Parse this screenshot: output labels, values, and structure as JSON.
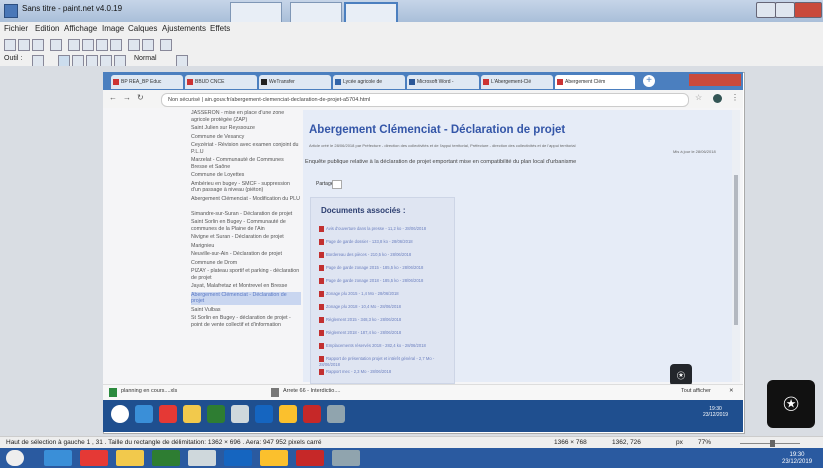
{
  "app": {
    "title": "Sans titre - paint.net v4.0.19"
  },
  "menu": [
    "Fichier",
    "Edition",
    "Affichage",
    "Image",
    "Calques",
    "Ajustements",
    "Effets"
  ],
  "toolbar": {
    "tool_label": "Outil :",
    "blend_label": "Normal"
  },
  "browser": {
    "tabs": [
      "BP REA_BP Educ",
      "BBUD CNCE",
      "WeTransfer",
      "Lycée agricole de",
      "Microsoft Word -",
      "L'Abergement-Clé",
      "Abergement Clém"
    ],
    "url": "Non sécurisé | ain.gouv.fr/abergement-clemenciat-declaration-de-projet-a5704.html"
  },
  "sidebar": {
    "items": [
      "JASSERON - mise en place d'une zone agricole protégée (ZAP)",
      "Saint Julien sur Reyssouze",
      "Commune de Vesancy",
      "Ceyzériat - Révision avec examen conjoint du P.L.U",
      "Marzelat - Communauté de Communes Bresse et Saône",
      "Commune de Loyettes",
      "Ambérieu en bugey - SMCF - suppression d'un passage à niveau (piéton)",
      "Abergement Clémenciat - Modification du PLU",
      "Simandre-sur-Suran - Déclaration de projet",
      "Saint Sorlin en Bugey - Communauté de communes de la Plaine de l'Ain",
      "Nivigne et Suran - Déclaration de projet",
      "Marignieu",
      "Neuville-sur-Ain - Déclaration de projet",
      "Commune de Drom",
      "PIZAY - plateau sportif et parking - déclaration de projet",
      "Jayat, Malafretaz et Montrevel en Bresse",
      "Abergement Clémenciat - Déclaration de projet",
      "Saint Vulbas",
      "St Sorlin en Bugey - déclaration de projet - point de vente collectif et d'information"
    ],
    "active_index": 16
  },
  "content": {
    "title": "Abergement Clémenciat - Déclaration de projet",
    "meta": "Article créé le 28/06/2018 par Préfecture - direction des collectivités et de l'appui territorial, Préfecture - direction des collectivités et de l'appui territorial",
    "meta_date": "Mis à jour le 28/06/2018",
    "intro": "Enquête publique relative à la déclaration de projet emportant mise en compatibilité du plan local d'urbanisme",
    "share_label": "Partager",
    "docs_title": "Documents associés :",
    "documents": [
      "Avis d'ouverture dans la presse - 11,2 ko - 28/06/2018",
      "Page de garde dossier - 133,8 ko - 28/06/2018",
      "Bordereau des pièces - 210,5 ko - 28/06/2018",
      "Page de garde zonage 2015 - 185,5 ko - 28/06/2018",
      "Page de garde zonage 2018 - 185,5 ko - 28/06/2018",
      "Zonage plu 2015 - 1,4 Mo - 28/06/2018",
      "Zonage plu 2018 - 10,4 Mo - 28/06/2018",
      "Règlement 2015 - 348,3 ko - 28/06/2018",
      "Règlement 2018 - 187,4 ko - 28/06/2018",
      "Emplacements réservés 2018 - 282,4 ko - 28/06/2018",
      "Rapport de présentation projet et intérêt général - 2,7 Mo - 28/06/2018",
      "Rapport mec - 2,3 Mo - 28/06/2018"
    ]
  },
  "downloads": {
    "items": [
      "planning en cours....xls",
      "Arrete 66 - Interdictio...."
    ],
    "show_all": "Tout afficher"
  },
  "inner_clock": {
    "time": "19:30",
    "date": "23/12/2019"
  },
  "status": {
    "selection": "Haut de sélection à gauche 1 , 31 . Taille du rectangle de délimitation: 1362 × 696 . Aera: 947 952 pixels carré",
    "size": "1366 × 768",
    "sel_size": "1362, 726",
    "zoom_unit": "px",
    "zoom": "77%"
  },
  "clock": {
    "time": "19:30",
    "date": "23/12/2019"
  }
}
